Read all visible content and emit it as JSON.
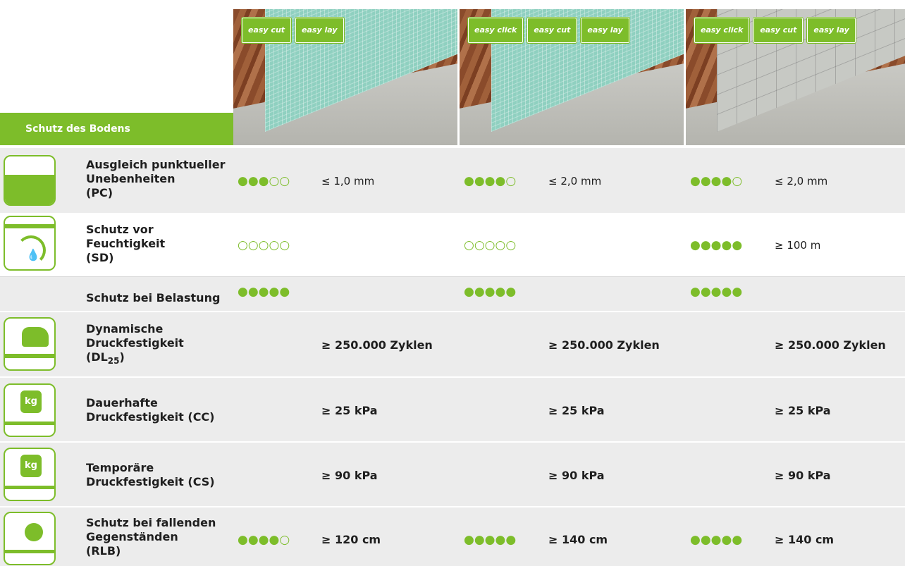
{
  "header": {
    "section_label": "Schutz des Bodens",
    "products": [
      {
        "badges": [
          "easy cut",
          "easy lay"
        ]
      },
      {
        "badges": [
          "easy click",
          "easy cut",
          "easy lay"
        ]
      },
      {
        "badges": [
          "easy click",
          "easy cut",
          "easy lay"
        ]
      }
    ]
  },
  "rows": [
    {
      "label": "Ausgleich punktueller Unebenheiten (PC)",
      "lines": [
        "Ausgleich punktueller",
        "Unebenheiten",
        "(PC)"
      ],
      "cells": [
        {
          "dots": "●●●○○",
          "value": "≤ 1,0 mm"
        },
        {
          "dots": "●●●●○",
          "value": "≤ 2,0 mm"
        },
        {
          "dots": "●●●●○",
          "value": "≤ 2,0 mm"
        }
      ]
    },
    {
      "label": "Schutz vor Feuchtigkeit (SD)",
      "lines": [
        "Schutz vor",
        "Feuchtigkeit",
        "(SD)"
      ],
      "cells": [
        {
          "dots": "○○○○○",
          "value": ""
        },
        {
          "dots": "○○○○○",
          "value": ""
        },
        {
          "dots": "●●●●●",
          "value": "≥ 100 m"
        }
      ]
    },
    {
      "label": "Schutz bei Belastung",
      "lines": [
        "Schutz bei Belastung"
      ],
      "cells": [
        {
          "dots": "●●●●●",
          "value": ""
        },
        {
          "dots": "●●●●●",
          "value": ""
        },
        {
          "dots": "●●●●●",
          "value": ""
        }
      ]
    },
    {
      "label": "Dynamische Druckfestigkeit (DL25)",
      "lines": [
        "Dynamische",
        "Druckfestigkeit",
        "(DL"
      ],
      "subscript": "25",
      "closing": ")",
      "cells": [
        {
          "value": "≥ 250.000 Zyklen"
        },
        {
          "value": "≥ 250.000 Zyklen"
        },
        {
          "value": "≥ 250.000 Zyklen"
        }
      ]
    },
    {
      "label": "Dauerhafte Druckfestigkeit (CC)",
      "lines": [
        "Dauerhafte",
        "Druckfestigkeit (CC)"
      ],
      "cells": [
        {
          "value": "≥ 25 kPa"
        },
        {
          "value": "≥ 25 kPa"
        },
        {
          "value": "≥ 25 kPa"
        }
      ]
    },
    {
      "label": "Temporäre Druckfestigkeit (CS)",
      "lines": [
        "Temporäre",
        "Druckfestigkeit (CS)"
      ],
      "cells": [
        {
          "value": "≥ 90 kPa"
        },
        {
          "value": "≥ 90 kPa"
        },
        {
          "value": "≥ 90 kPa"
        }
      ]
    },
    {
      "label": "Schutz bei fallenden Gegenständen (RLB)",
      "lines": [
        "Schutz bei fallenden",
        "Gegenständen",
        "(RLB)"
      ],
      "cells": [
        {
          "dots": "●●●●○",
          "value": "≥ 120 cm"
        },
        {
          "dots": "●●●●●",
          "value": "≥ 140 cm"
        },
        {
          "dots": "●●●●●",
          "value": "≥ 140 cm"
        }
      ]
    }
  ],
  "icon_text": {
    "kg": "kg"
  },
  "colors": {
    "accent": "#7dbd2a",
    "shade": "#ececec"
  }
}
